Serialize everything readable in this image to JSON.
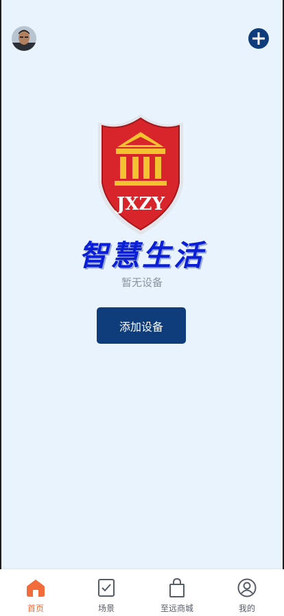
{
  "header": {
    "avatar_alt": "avatar",
    "add_icon": "plus-circle-icon"
  },
  "logo": {
    "text": "JXZY"
  },
  "main": {
    "slogan": "智慧生活",
    "empty_text": "暂无设备",
    "add_device_label": "添加设备"
  },
  "tabbar": {
    "items": [
      {
        "label": "首页",
        "icon": "home-icon",
        "active": true
      },
      {
        "label": "场景",
        "icon": "checkbox-icon",
        "active": false
      },
      {
        "label": "至远商城",
        "icon": "shopping-bag-icon",
        "active": false
      },
      {
        "label": "我的",
        "icon": "user-icon",
        "active": false
      }
    ]
  },
  "colors": {
    "page_bg": "#e8f3fd",
    "primary": "#0f3d7b",
    "active_tab": "#f26b3a",
    "shield_red": "#d8242b",
    "shield_gold": "#f2c230",
    "slogan_blue": "#0a1fd6"
  }
}
